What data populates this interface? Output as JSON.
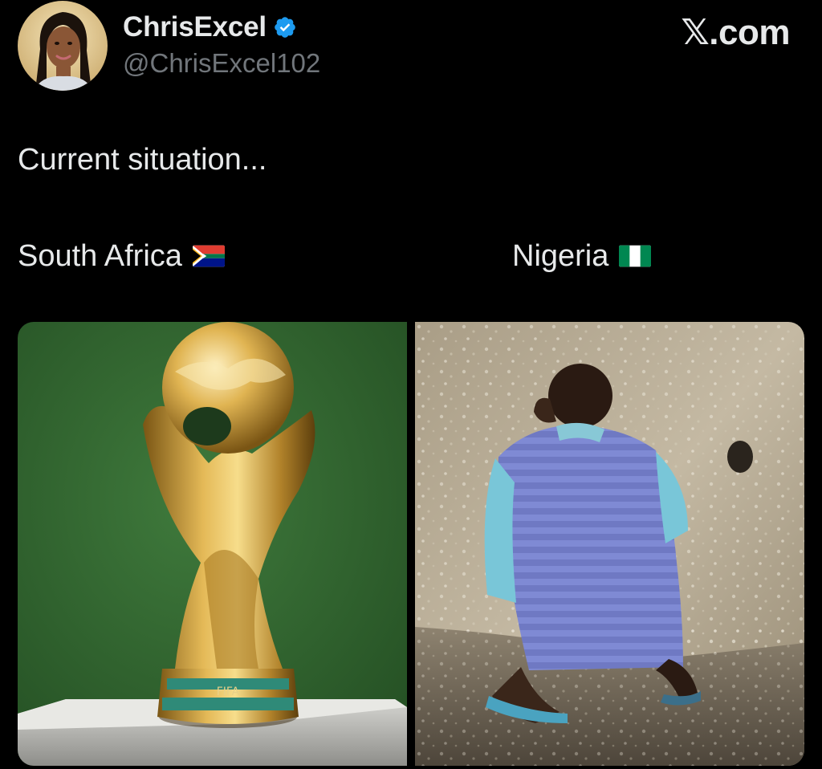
{
  "author": {
    "display_name": "ChrisExcel",
    "handle": "@ChrisExcel102",
    "avatar_icon": "profile-photo",
    "verified_icon": "verified-badge-icon"
  },
  "brand": {
    "label": "𝕏.com"
  },
  "tweet": {
    "text": "Current situation..."
  },
  "columns": [
    {
      "label": "South Africa",
      "flag_icon": "south-africa-flag-icon",
      "image": "world-cup-trophy-photo"
    },
    {
      "label": "Nigeria",
      "flag_icon": "nigeria-flag-icon",
      "image": "man-squatting-by-wall-photo"
    }
  ],
  "colors": {
    "background": "#000000",
    "primary_text": "#e7e9ea",
    "secondary_text": "#71767b",
    "verified_blue": "#1d9bf0"
  }
}
